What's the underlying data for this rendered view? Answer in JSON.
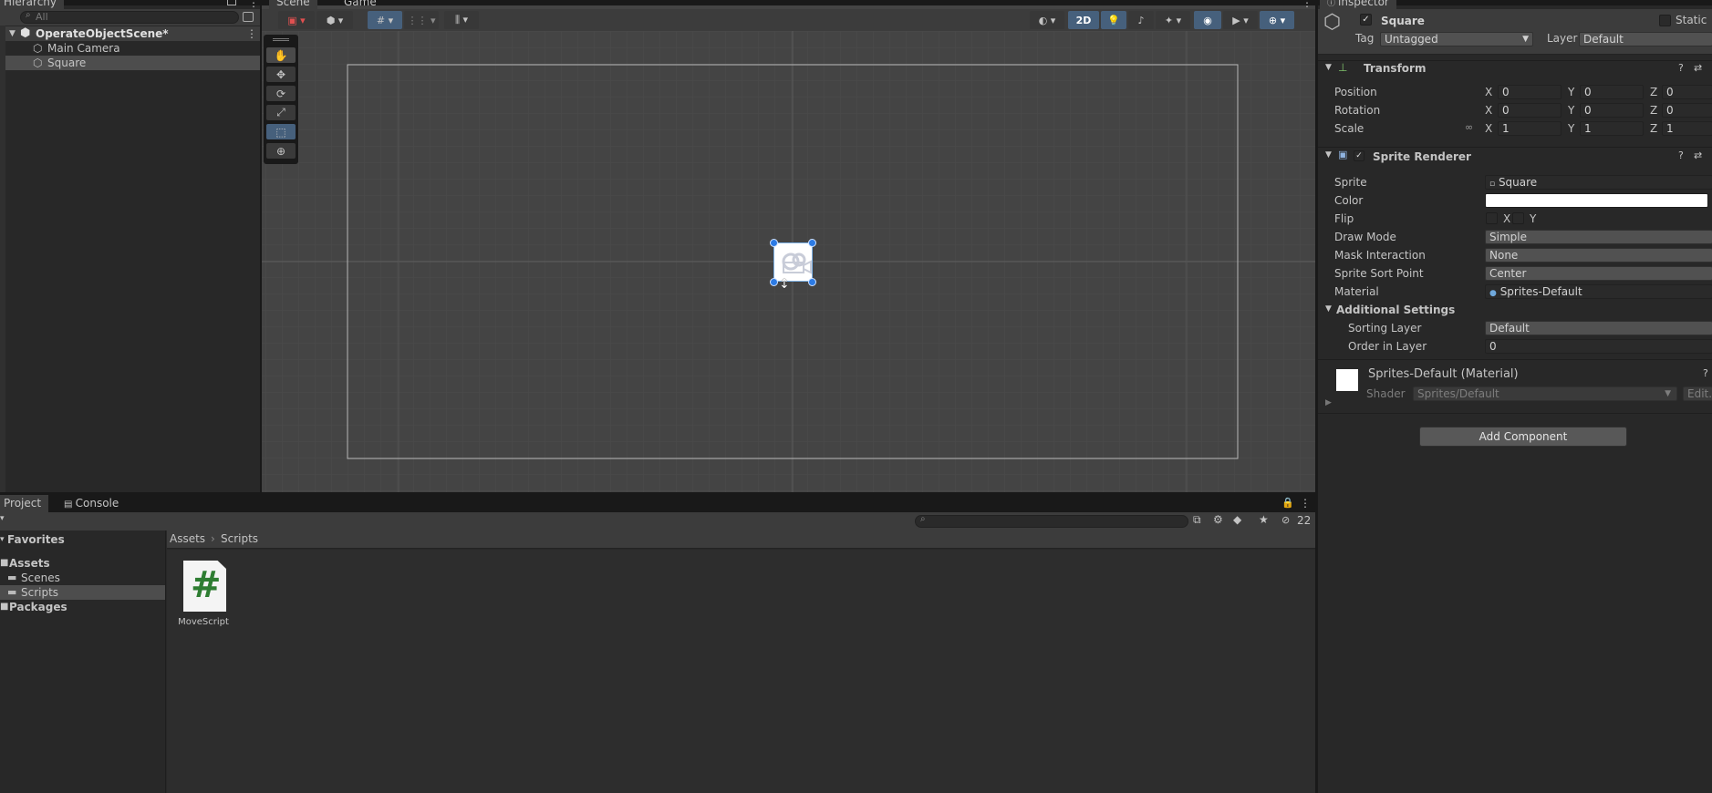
{
  "hierarchy": {
    "tab_label": "Hierarchy",
    "search_placeholder": "All",
    "scene_name": "OperateObjectScene*",
    "items": [
      {
        "label": "Main Camera"
      },
      {
        "label": "Square"
      }
    ]
  },
  "scene_view": {
    "tabs": [
      {
        "label": "Scene"
      },
      {
        "label": "Game"
      }
    ],
    "toolbar": {
      "mode_2d_label": "2D"
    }
  },
  "project": {
    "tabs": [
      {
        "label": "Project"
      },
      {
        "label": "Console"
      }
    ],
    "hidden_count": "22",
    "tree": {
      "favorites_label": "Favorites",
      "assets_label": "Assets",
      "children": [
        {
          "label": "Scenes"
        },
        {
          "label": "Scripts"
        }
      ],
      "packages_label": "Packages"
    },
    "breadcrumb": {
      "root": "Assets",
      "current": "Scripts"
    },
    "assets": [
      {
        "name": "MoveScript",
        "glyph": "#"
      }
    ]
  },
  "inspector": {
    "tab_label": "Inspector",
    "object_name": "Square",
    "static_label": "Static",
    "tag_label": "Tag",
    "tag_value": "Untagged",
    "layer_label": "Layer",
    "layer_value": "Default",
    "transform": {
      "title": "Transform",
      "position_label": "Position",
      "rotation_label": "Rotation",
      "scale_label": "Scale",
      "position": {
        "x": "0",
        "y": "0",
        "z": "0"
      },
      "rotation": {
        "x": "0",
        "y": "0",
        "z": "0"
      },
      "scale": {
        "x": "1",
        "y": "1",
        "z": "1"
      }
    },
    "sprite_renderer": {
      "title": "Sprite Renderer",
      "sprite_label": "Sprite",
      "sprite_value": "Square",
      "color_label": "Color",
      "color_value": "#ffffff",
      "flip_label": "Flip",
      "flip_x": "X",
      "flip_y": "Y",
      "draw_mode_label": "Draw Mode",
      "draw_mode_value": "Simple",
      "mask_label": "Mask Interaction",
      "mask_value": "None",
      "sort_point_label": "Sprite Sort Point",
      "sort_point_value": "Center",
      "material_label": "Material",
      "material_value": "Sprites-Default",
      "additional_title": "Additional Settings",
      "sorting_layer_label": "Sorting Layer",
      "sorting_layer_value": "Default",
      "order_label": "Order in Layer",
      "order_value": "0"
    },
    "material_section": {
      "title": "Sprites-Default (Material)",
      "shader_label": "Shader",
      "shader_value": "Sprites/Default",
      "edit_label": "Edit..."
    },
    "add_component_label": "Add Component"
  },
  "colors": {
    "accent": "#46607c",
    "selection": "#2c5d87",
    "csharp_green": "#2e7d32"
  }
}
